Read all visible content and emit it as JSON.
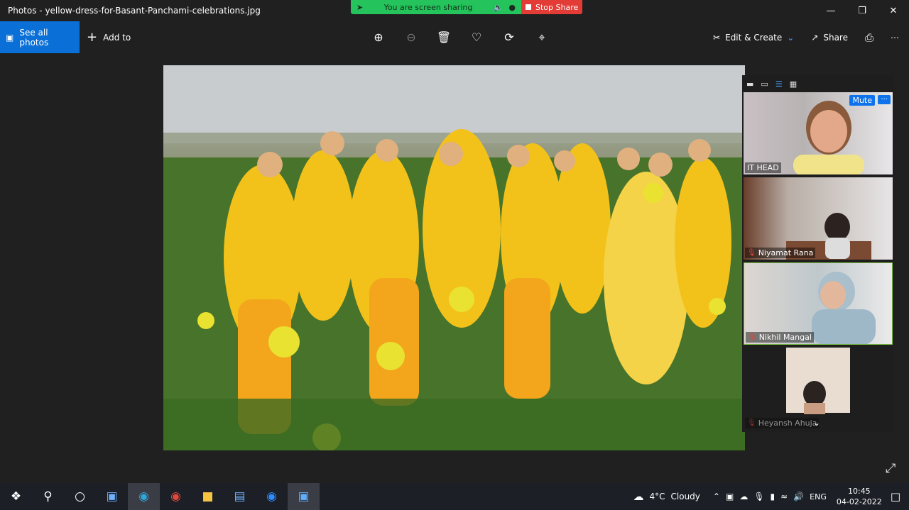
{
  "window": {
    "title": "Photos - yellow-dress-for-Basant-Panchami-celebrations.jpg"
  },
  "screen_share": {
    "status": "You are screen sharing",
    "stop_label": "Stop Share"
  },
  "toolbar": {
    "see_all_photos": "See all photos",
    "add_to": "Add to",
    "edit_create": "Edit & Create",
    "share": "Share"
  },
  "zoom": {
    "mute_label": "Mute",
    "participants": [
      {
        "name": "IT HEAD"
      },
      {
        "name": "Niyamat Rana"
      },
      {
        "name": "Nikhil Mangal"
      },
      {
        "name": "Heyansh Ahuja"
      }
    ]
  },
  "taskbar": {
    "weather_temp": "4°C",
    "weather_desc": "Cloudy",
    "language": "ENG",
    "time": "10:45",
    "date": "04-02-2022"
  },
  "colors": {
    "accent": "#0a6fd6",
    "share_green": "#24c35c",
    "stop_red": "#e33b36",
    "zoom_blue": "#0e72ed"
  }
}
